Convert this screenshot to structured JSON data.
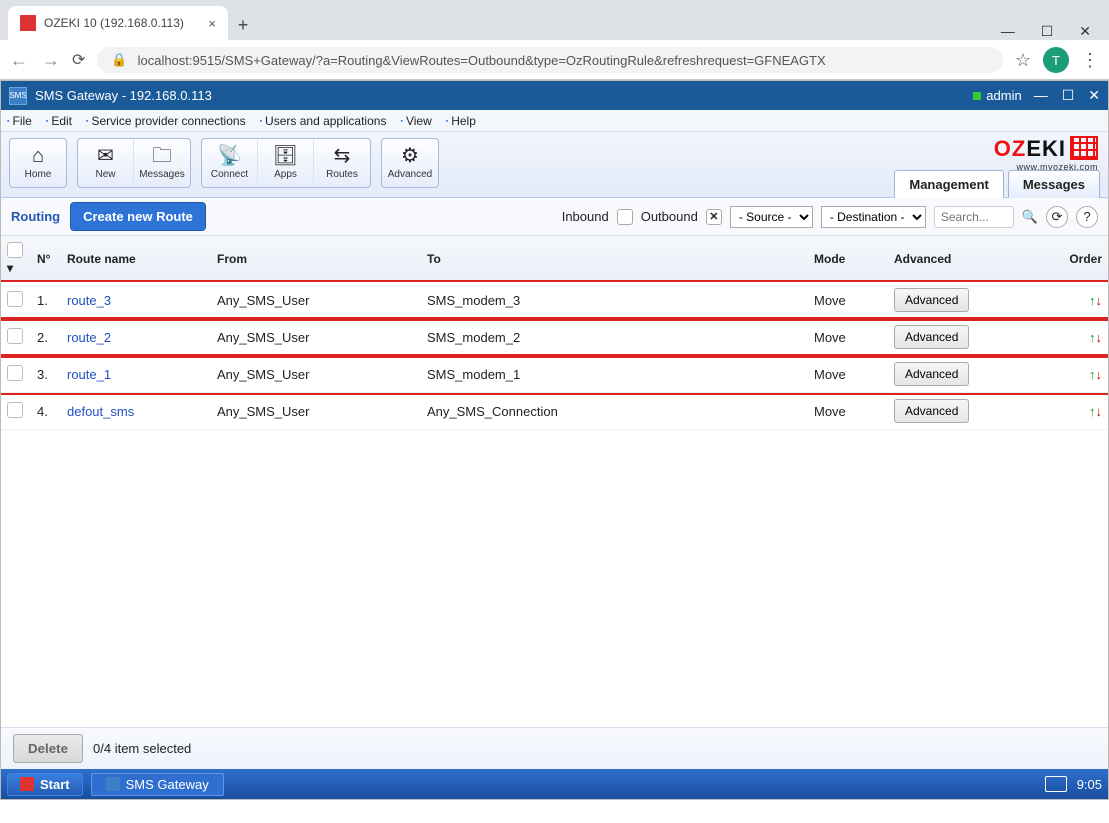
{
  "browser": {
    "tab_title": "OZEKI 10 (192.168.0.113)",
    "url": "localhost:9515/SMS+Gateway/?a=Routing&ViewRoutes=Outbound&type=OzRoutingRule&refreshrequest=GFNEAGTX",
    "avatar_letter": "T"
  },
  "app": {
    "title": "SMS Gateway - 192.168.0.113",
    "user": "admin"
  },
  "menu": {
    "file": "File",
    "edit": "Edit",
    "spc": "Service provider connections",
    "usersapps": "Users and applications",
    "view": "View",
    "help": "Help"
  },
  "brand": {
    "name_a": "OZ",
    "name_b": "EKI",
    "url": "www.myozeki.com"
  },
  "toolbar": {
    "home": "Home",
    "new": "New",
    "messages": "Messages",
    "connect": "Connect",
    "apps": "Apps",
    "routes": "Routes",
    "advanced": "Advanced"
  },
  "tabs": {
    "management": "Management",
    "messages": "Messages"
  },
  "subbar": {
    "routing": "Routing",
    "create": "Create new Route",
    "inbound": "Inbound",
    "outbound": "Outbound",
    "source_sel": "- Source -",
    "dest_sel": "- Destination -",
    "search_placeholder": "Search..."
  },
  "table": {
    "headers": {
      "n": "N°",
      "route": "Route name",
      "from": "From",
      "to": "To",
      "mode": "Mode",
      "advanced": "Advanced",
      "order": "Order"
    },
    "adv_btn": "Advanced",
    "rows": [
      {
        "n": "1.",
        "name": "route_3",
        "from": "Any_SMS_User",
        "to": "SMS_modem_3",
        "mode": "Move",
        "hl": true
      },
      {
        "n": "2.",
        "name": "route_2",
        "from": "Any_SMS_User",
        "to": "SMS_modem_2",
        "mode": "Move",
        "hl": true
      },
      {
        "n": "3.",
        "name": "route_1",
        "from": "Any_SMS_User",
        "to": "SMS_modem_1",
        "mode": "Move",
        "hl": true
      },
      {
        "n": "4.",
        "name": "defout_sms",
        "from": "Any_SMS_User",
        "to": "Any_SMS_Connection",
        "mode": "Move",
        "hl": false
      }
    ]
  },
  "footer": {
    "delete": "Delete",
    "selection": "0/4 item selected"
  },
  "taskbar": {
    "start": "Start",
    "app": "SMS Gateway",
    "clock": "9:05"
  }
}
